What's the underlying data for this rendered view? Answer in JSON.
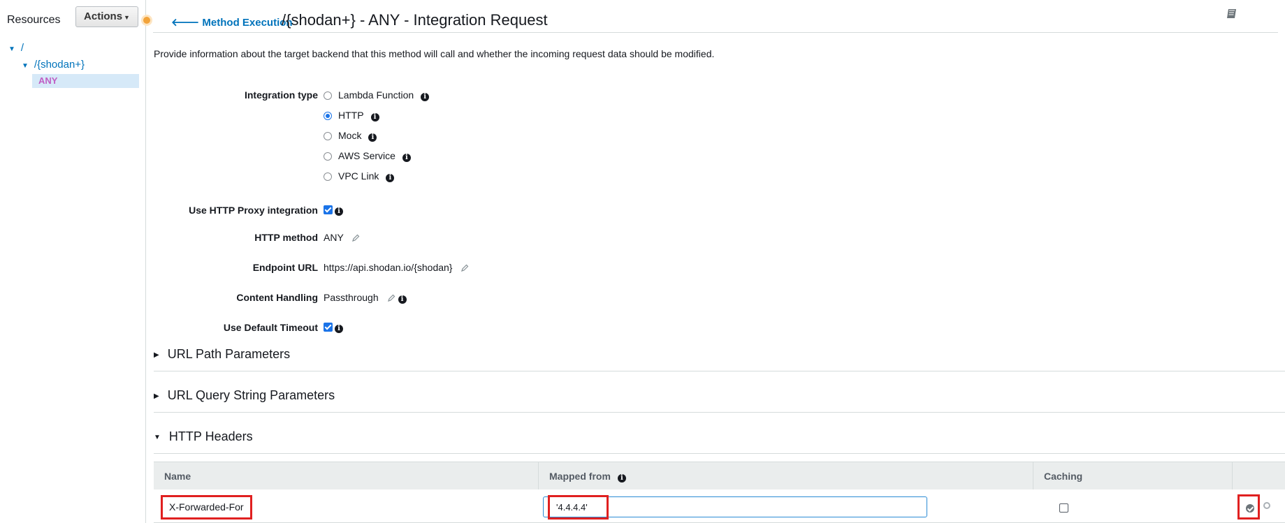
{
  "sidebar": {
    "title": "Resources",
    "actions_label": "Actions",
    "tree": [
      {
        "label": "/",
        "expanded": true
      },
      {
        "label": "/{shodan+}",
        "expanded": true
      },
      {
        "label": "ANY",
        "selected": true
      }
    ]
  },
  "header": {
    "back_link": "Method Execution",
    "title": "/{shodan+} - ANY - Integration Request",
    "book_icon": "book-icon"
  },
  "description": "Provide information about the target backend that this method will call and whether the incoming request data should be modified.",
  "form": {
    "integration_type_label": "Integration type",
    "integration_options": [
      {
        "label": "Lambda Function",
        "selected": false
      },
      {
        "label": "HTTP",
        "selected": true
      },
      {
        "label": "Mock",
        "selected": false
      },
      {
        "label": "AWS Service",
        "selected": false
      },
      {
        "label": "VPC Link",
        "selected": false
      }
    ],
    "proxy_label": "Use HTTP Proxy integration",
    "proxy_checked": true,
    "http_method_label": "HTTP method",
    "http_method_value": "ANY",
    "endpoint_label": "Endpoint URL",
    "endpoint_value": "https://api.shodan.io/{shodan}",
    "content_handling_label": "Content Handling",
    "content_handling_value": "Passthrough",
    "timeout_label": "Use Default Timeout",
    "timeout_checked": true
  },
  "sections": [
    {
      "label": "URL Path Parameters",
      "expanded": false
    },
    {
      "label": "URL Query String Parameters",
      "expanded": false
    },
    {
      "label": "HTTP Headers",
      "expanded": true
    }
  ],
  "headers_table": {
    "columns": [
      "Name",
      "Mapped from",
      "Caching"
    ],
    "rows": [
      {
        "name": "X-Forwarded-For",
        "mapped_from": "'4.4.4.4'",
        "caching": false
      }
    ]
  },
  "colors": {
    "link": "#0073bb",
    "highlight_border": "#e02020",
    "accent": "#1a73e8"
  }
}
